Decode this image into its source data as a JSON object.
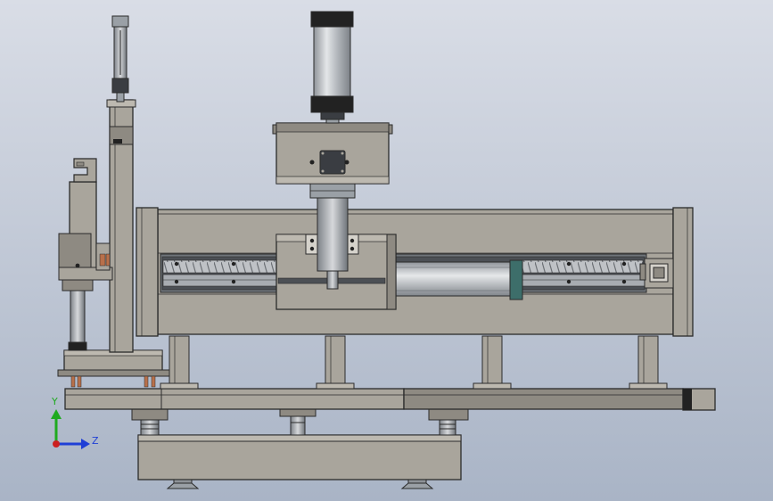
{
  "viewport": {
    "background_top": "#d9dde6",
    "background_bottom": "#a9b4c6"
  },
  "colors": {
    "frame": "#a9a59c",
    "frame_dark": "#8e8a82",
    "edge": "#2b2b2b",
    "steel": "#c9ccd0",
    "cylinder_teal": "#3d6e6a",
    "copper": "#b8704a",
    "black_part": "#222222"
  },
  "triad": {
    "y_label": "Y",
    "z_label": "Z",
    "y_color": "#1faa1f",
    "z_color": "#1f3fd6",
    "origin_color": "#cc1f1f"
  }
}
